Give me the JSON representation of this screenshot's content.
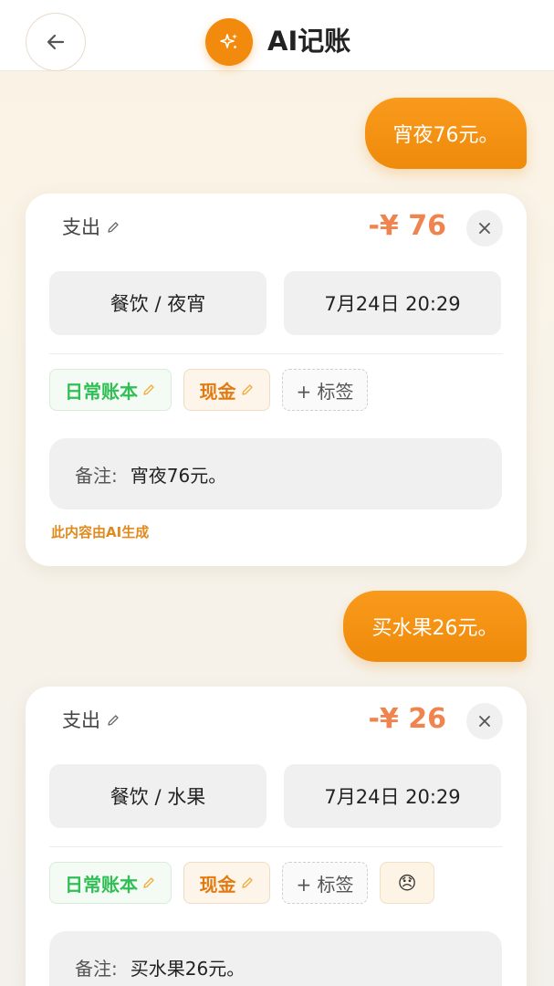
{
  "header": {
    "title": "AI记账",
    "back_icon": "arrow-left-icon",
    "brand_icon": "sparkle-icon",
    "accent": "#F28A0E"
  },
  "messages": [
    {
      "user_text": "宵夜76元。",
      "record": {
        "type": "支出",
        "amount": "-¥ 76",
        "category": "餐饮 / 夜宵",
        "datetime": "7月24日 20:29",
        "ledger": "日常账本",
        "account": "现金",
        "tag_add": "+ 标签",
        "note_label": "备注:",
        "note": "宵夜76元。",
        "ai_notice": "此内容由AI生成"
      }
    },
    {
      "user_text": "买水果26元。",
      "record": {
        "type": "支出",
        "amount": "-¥ 26",
        "category": "餐饮 / 水果",
        "datetime": "7月24日 20:29",
        "ledger": "日常账本",
        "account": "现金",
        "tag_add": "+ 标签",
        "mood_icon": "disappointed-face-icon",
        "mood_emoji": "😞",
        "note_label": "备注:",
        "note": "买水果26元。"
      }
    }
  ],
  "colors": {
    "amount": "#F0844E",
    "ledger_green": "#2FBF55",
    "account_orange": "#E27A12",
    "bubble": "#F28A0E"
  }
}
